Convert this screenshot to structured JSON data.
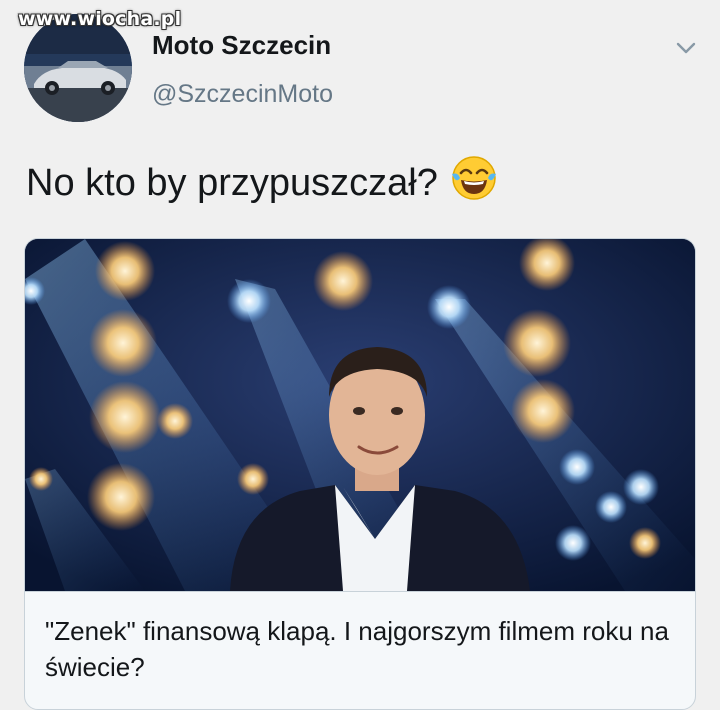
{
  "watermark": "www.wiocha.pl",
  "tweet": {
    "author_name": "Moto Szczecin",
    "author_handle": "@SzczecinMoto",
    "text": "No kto by przypuszczał?",
    "emoji": "face-with-tears-of-joy",
    "menu_icon": "chevron-down-icon"
  },
  "card": {
    "title": "\"Zenek\" finansową klapą. I najgorszym filmem roku na świecie?"
  }
}
